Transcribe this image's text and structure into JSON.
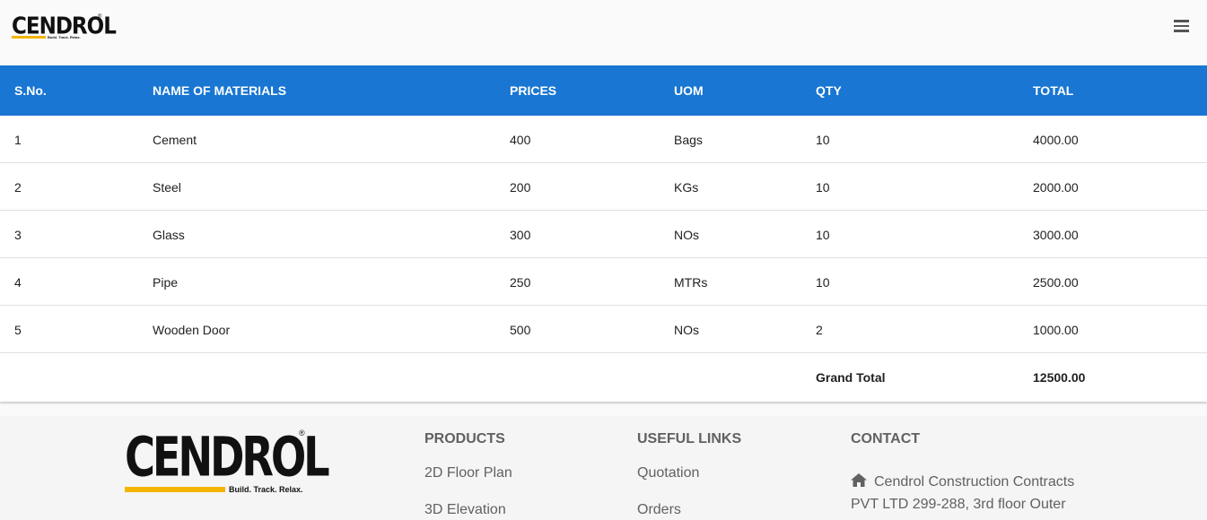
{
  "header": {
    "logo_text": "CENDROL",
    "logo_tagline": "Build. Track. Relax.",
    "logo_registered": "®",
    "menu_icon": "hamburger-menu-icon"
  },
  "table": {
    "columns": [
      "S.No.",
      "NAME OF MATERIALS",
      "PRICES",
      "UOM",
      "QTY",
      "TOTAL"
    ],
    "rows": [
      {
        "sno": "1",
        "name": "Cement",
        "price": "400",
        "uom": "Bags",
        "qty": "10",
        "total": "4000.00"
      },
      {
        "sno": "2",
        "name": "Steel",
        "price": "200",
        "uom": "KGs",
        "qty": "10",
        "total": "2000.00"
      },
      {
        "sno": "3",
        "name": "Glass",
        "price": "300",
        "uom": "NOs",
        "qty": "10",
        "total": "3000.00"
      },
      {
        "sno": "4",
        "name": "Pipe",
        "price": "250",
        "uom": "MTRs",
        "qty": "10",
        "total": "2500.00"
      },
      {
        "sno": "5",
        "name": "Wooden Door",
        "price": "500",
        "uom": "NOs",
        "qty": "2",
        "total": "1000.00"
      }
    ],
    "grand_total_label": "Grand Total",
    "grand_total_value": "12500.00",
    "header_color": "#1976d2"
  },
  "footer": {
    "logo_text": "CENDROL",
    "logo_tagline": "Build. Track. Relax.",
    "logo_registered": "®",
    "products": {
      "title": "PRODUCTS",
      "links": [
        "2D Floor Plan",
        "3D Elevation"
      ]
    },
    "useful_links": {
      "title": "USEFUL LINKS",
      "links": [
        "Quotation",
        "Orders"
      ]
    },
    "contact": {
      "title": "CONTACT",
      "icon": "home-icon",
      "address": "Cendrol Construction Contracts PVT LTD 299-288, 3rd floor Outer"
    }
  },
  "colors": {
    "accent": "#1976d2",
    "logo_bar": "#f4b400",
    "footer_text": "#616161"
  }
}
